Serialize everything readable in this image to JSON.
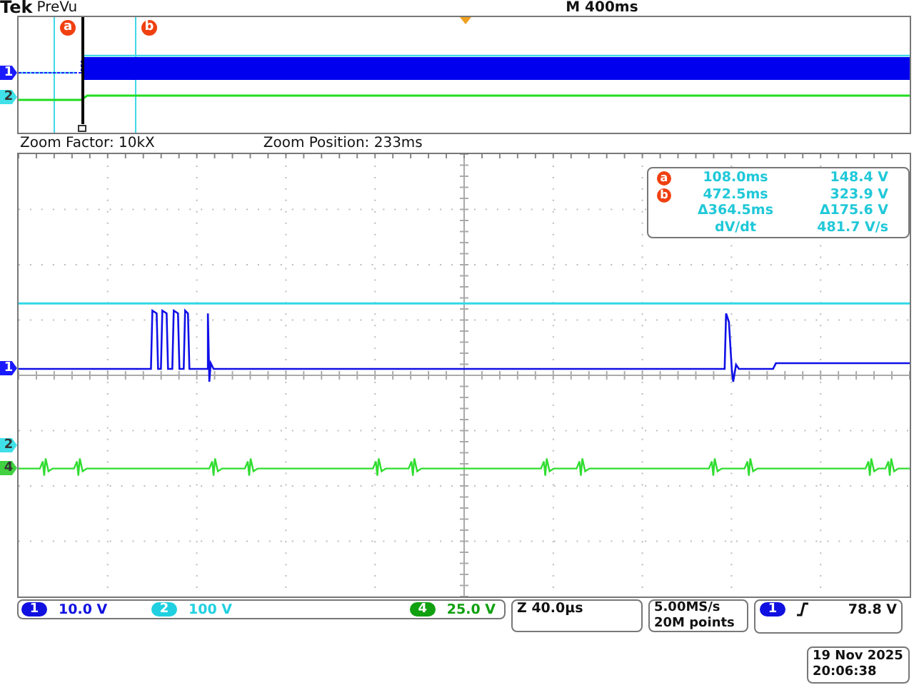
{
  "header": {
    "brand": "Tek",
    "mode": "PreVu",
    "timebase": "M 400ms"
  },
  "overview": {
    "cursors": [
      {
        "label": "a"
      },
      {
        "label": "b"
      }
    ],
    "markers": [
      {
        "label": "1",
        "color": "#1a1aff"
      },
      {
        "label": "2",
        "color": "#40e0e8"
      }
    ]
  },
  "zoom_info": {
    "factor": "Zoom Factor: 10kX",
    "position": "Zoom Position: 233ms"
  },
  "main": {
    "markers": [
      {
        "label": "1",
        "color": "#1a1aff"
      },
      {
        "label": "2",
        "color": "#40e0e8"
      },
      {
        "label": "4",
        "color": "#40d040"
      }
    ]
  },
  "readout": [
    {
      "cursor": "a",
      "time": "108.0ms",
      "value": "148.4 V"
    },
    {
      "cursor": "b",
      "time": "472.5ms",
      "value": "323.9 V"
    },
    {
      "time": "Δ364.5ms",
      "value": "Δ175.6 V"
    },
    {
      "time": "dV/dt",
      "value": "481.7 V/s"
    }
  ],
  "channels": [
    {
      "number": "1",
      "scale": "10.0 V",
      "color": "#1010e0"
    },
    {
      "number": "2",
      "scale": "100 V",
      "color": "#20d0e0"
    },
    {
      "number": "4",
      "scale": "25.0 V",
      "color": "#10a010"
    }
  ],
  "horizontal": {
    "zoom_scale": "Z 40.0µs",
    "sample_rate": "5.00MS/s",
    "record_length": "20M points"
  },
  "trigger": {
    "source": "1",
    "color": "#1010e0",
    "level": "78.8 V"
  },
  "datetime": {
    "date": "19 Nov 2025",
    "time": "20:06:38"
  }
}
